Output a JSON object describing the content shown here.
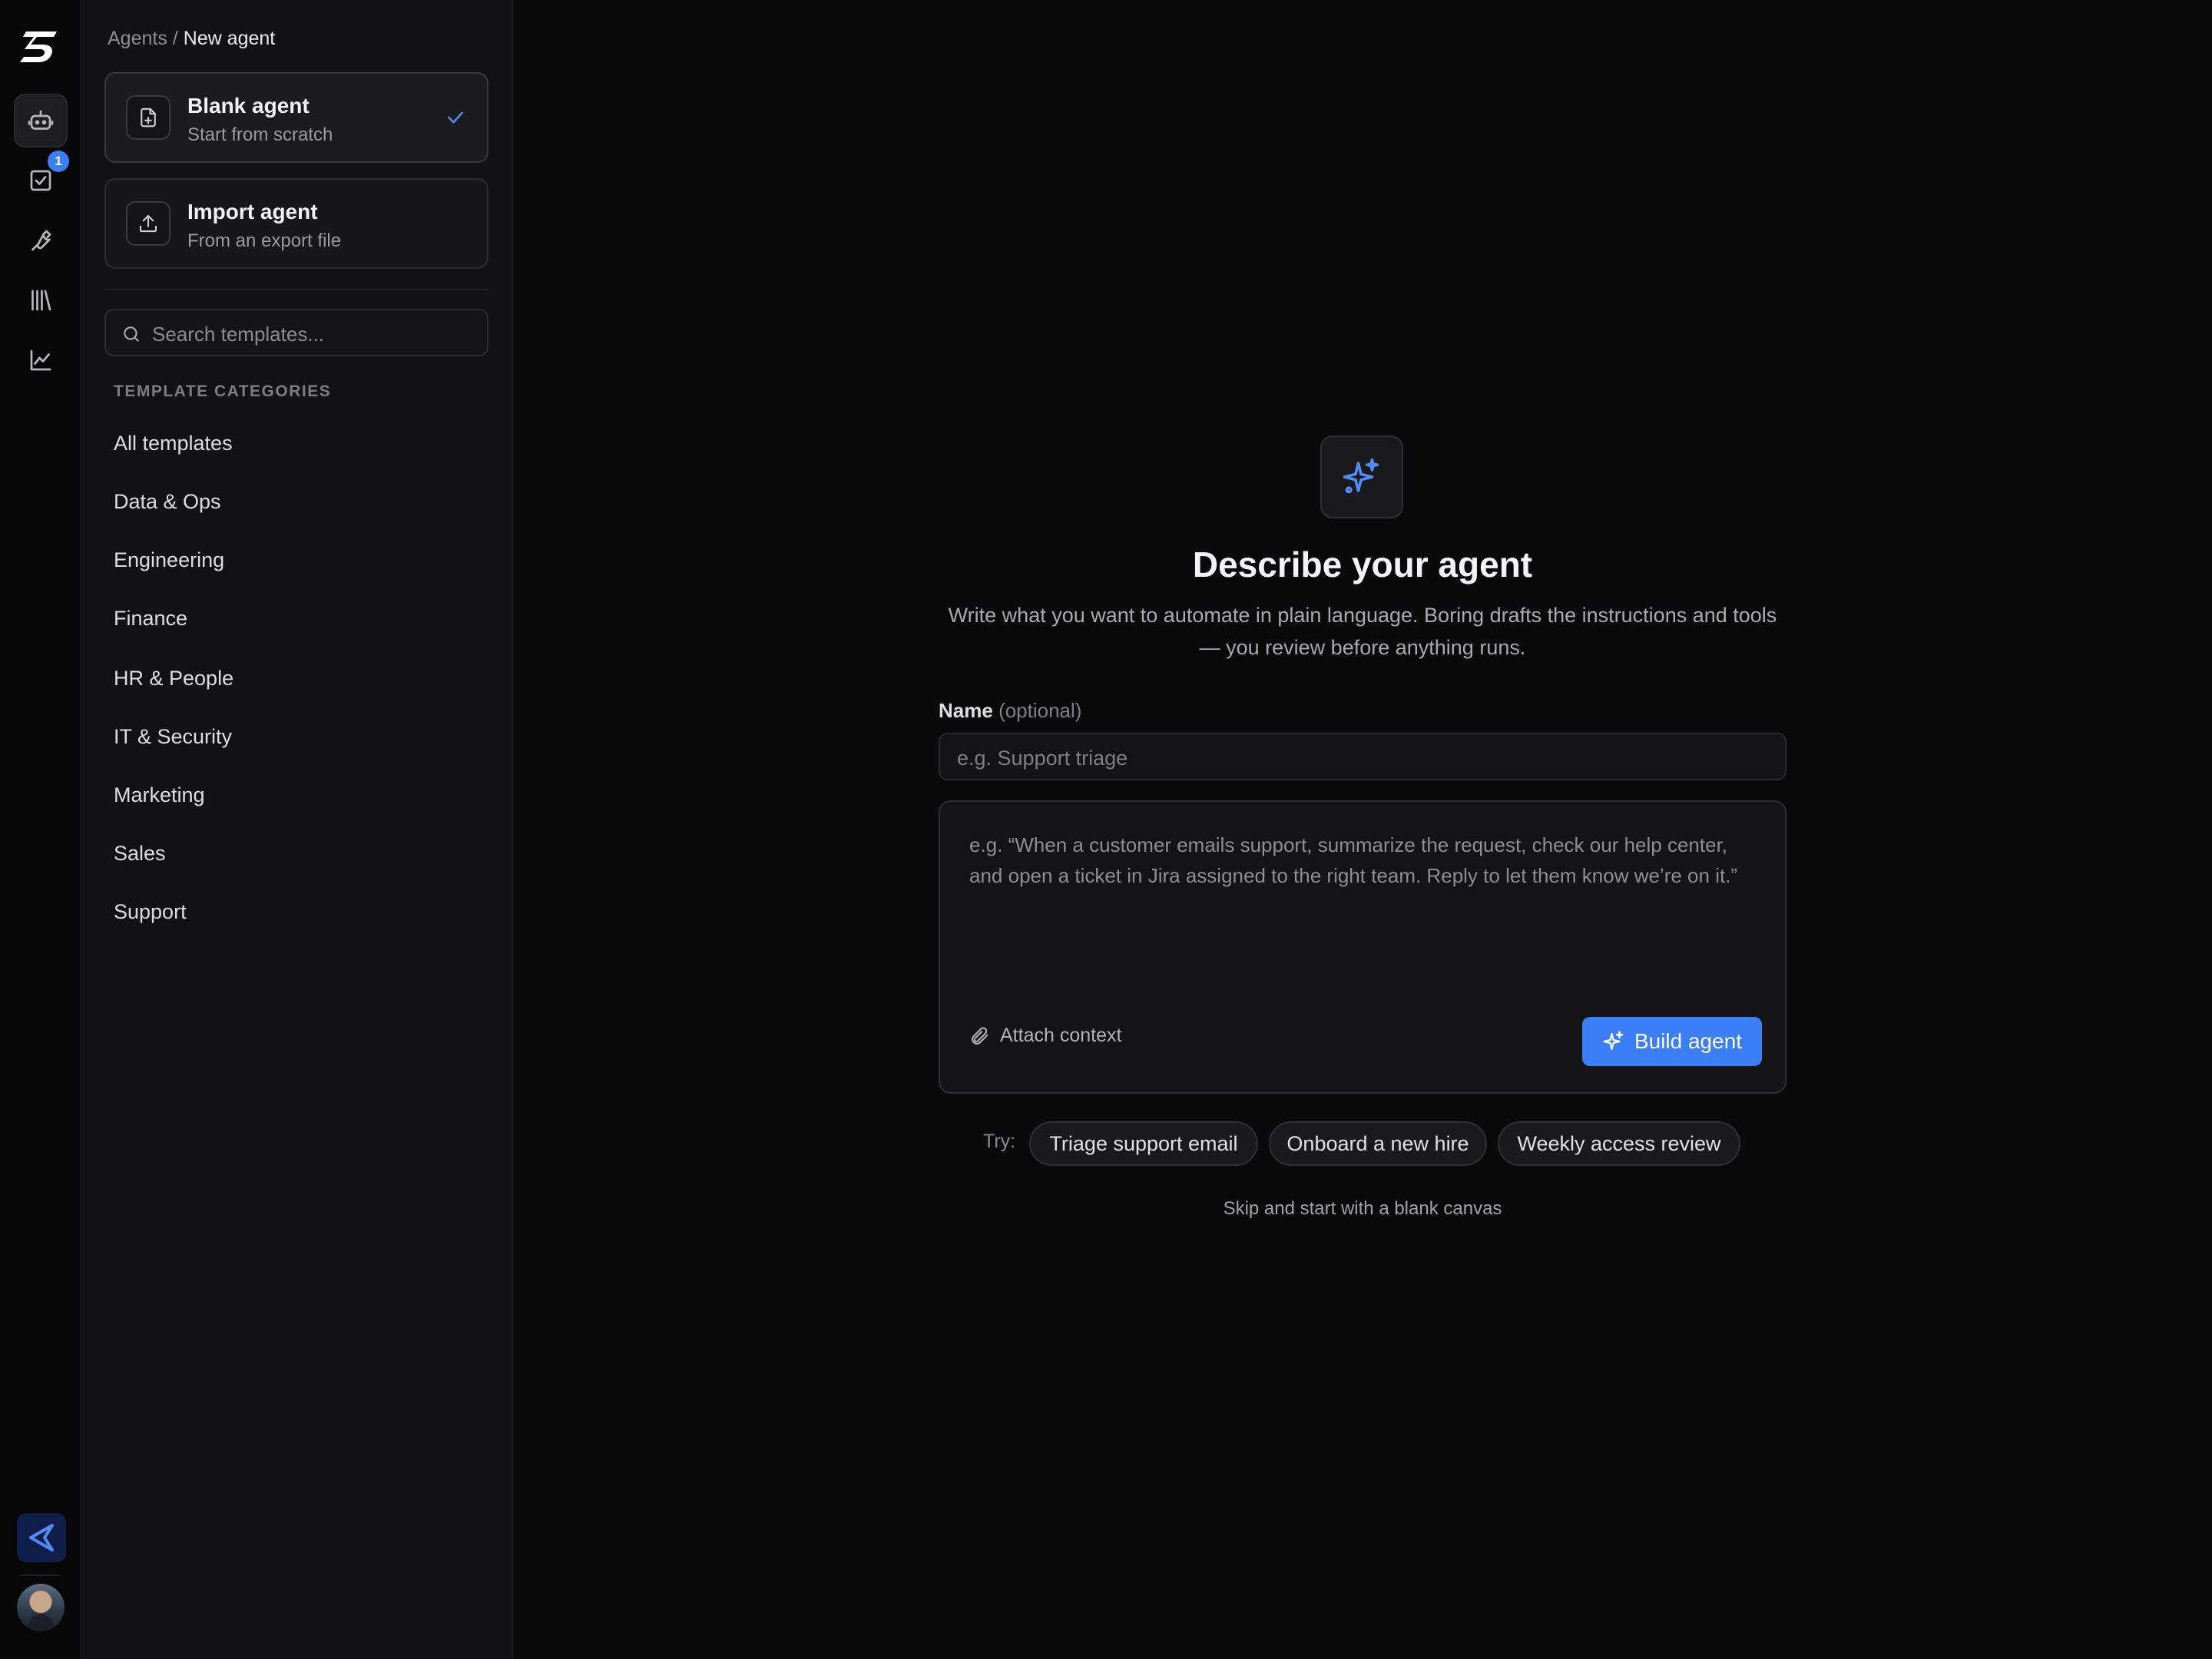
{
  "breadcrumb": {
    "parent": "Agents",
    "separator": "/",
    "current": "New agent"
  },
  "rail": {
    "logo_icon": "b-logo-icon",
    "nav_icons": [
      "agents-bot-icon",
      "tasks-checkbox-icon",
      "tools-wrench-icon",
      "library-icon",
      "analytics-chart-icon"
    ],
    "tasks_badge": "1",
    "accent": "#3b7ef6"
  },
  "options": [
    {
      "title": "Blank agent",
      "subtitle": "Start from scratch",
      "icon": "file-plus-icon",
      "selected": true
    },
    {
      "title": "Import agent",
      "subtitle": "From an export file",
      "icon": "upload-icon",
      "selected": false
    }
  ],
  "search": {
    "placeholder": "Search templates..."
  },
  "categories": {
    "heading": "TEMPLATE CATEGORIES",
    "items": [
      "All templates",
      "Data & Ops",
      "Engineering",
      "Finance",
      "HR & People",
      "IT & Security",
      "Marketing",
      "Sales",
      "Support"
    ]
  },
  "main": {
    "icon": "sparkles-icon",
    "title": "Describe your agent",
    "subtitle": "Write what you want to automate in plain language. Boring drafts the instructions and tools — you review before anything runs.",
    "name_label": "Name",
    "name_optional": "(optional)",
    "name_placeholder": "e.g. Support triage",
    "prompt_placeholder": "e.g. “When a customer emails support, summarize the request, check our help center, and open a ticket in Jira assigned to the right team. Reply to let them know we’re on it.”",
    "attach_label": "Attach context",
    "build_label": "Build agent",
    "try_label": "Try:",
    "suggestions": [
      "Triage support email",
      "Onboard a new hire",
      "Weekly access review"
    ],
    "skip_label": "Skip and start with a blank canvas"
  }
}
